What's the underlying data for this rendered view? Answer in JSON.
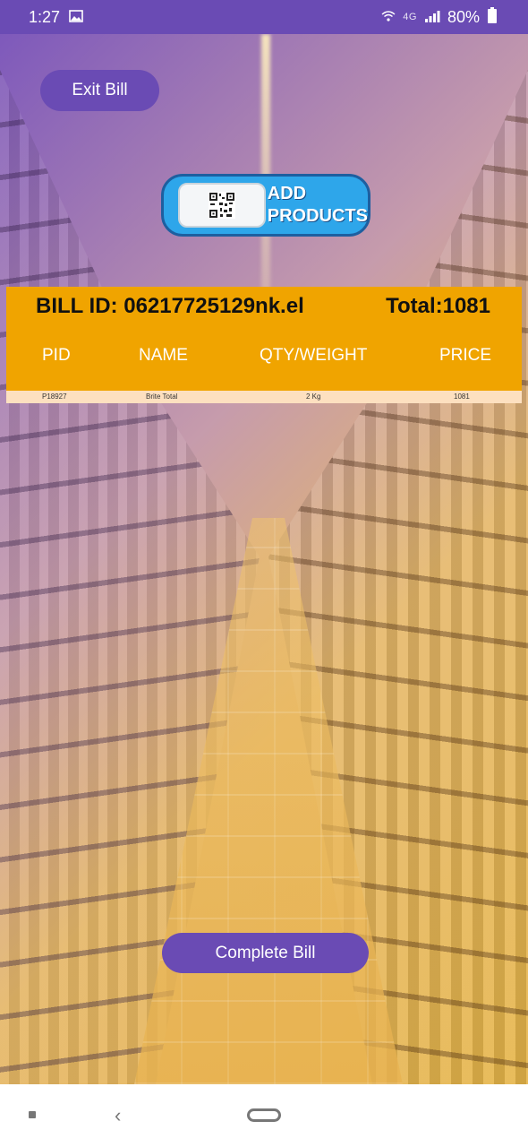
{
  "status_bar": {
    "time": "1:27",
    "network": "4G",
    "battery": "80%"
  },
  "header": {
    "exit_label": "Exit Bill"
  },
  "add_products": {
    "line1": "ADD",
    "line2": "PRODUCTS"
  },
  "bill": {
    "bill_id_text": "BILL ID: 06217725129nk.el",
    "total_text": "Total:1081",
    "columns": [
      "PID",
      "NAME",
      "QTY/WEIGHT",
      "PRICE"
    ],
    "rows": [
      {
        "pid": "P18927",
        "name": "Brite Total",
        "qty": "2 Kg",
        "price": "1081"
      }
    ]
  },
  "footer": {
    "complete_label": "Complete Bill"
  },
  "colors": {
    "accent_purple": "#6a4bb4",
    "bill_header_orange": "#f0a400",
    "row_bg": "#fde0c0",
    "add_button_blue": "#2ea6ea"
  }
}
